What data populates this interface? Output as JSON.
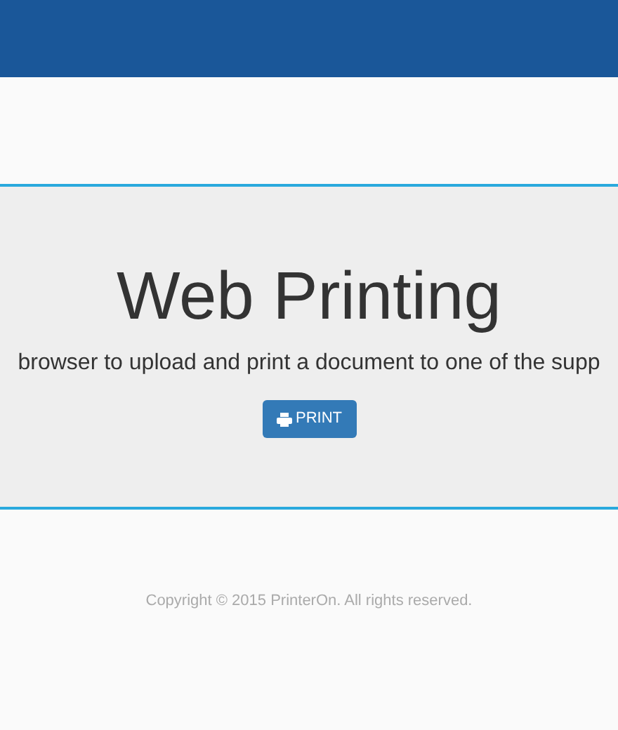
{
  "hero": {
    "title": "Web Printing",
    "description": "browser to upload and print a document to one of the supp",
    "button": "PRINT"
  },
  "footer": {
    "copyright": "Copyright © 2015 PrinterOn. All rights reserved."
  }
}
